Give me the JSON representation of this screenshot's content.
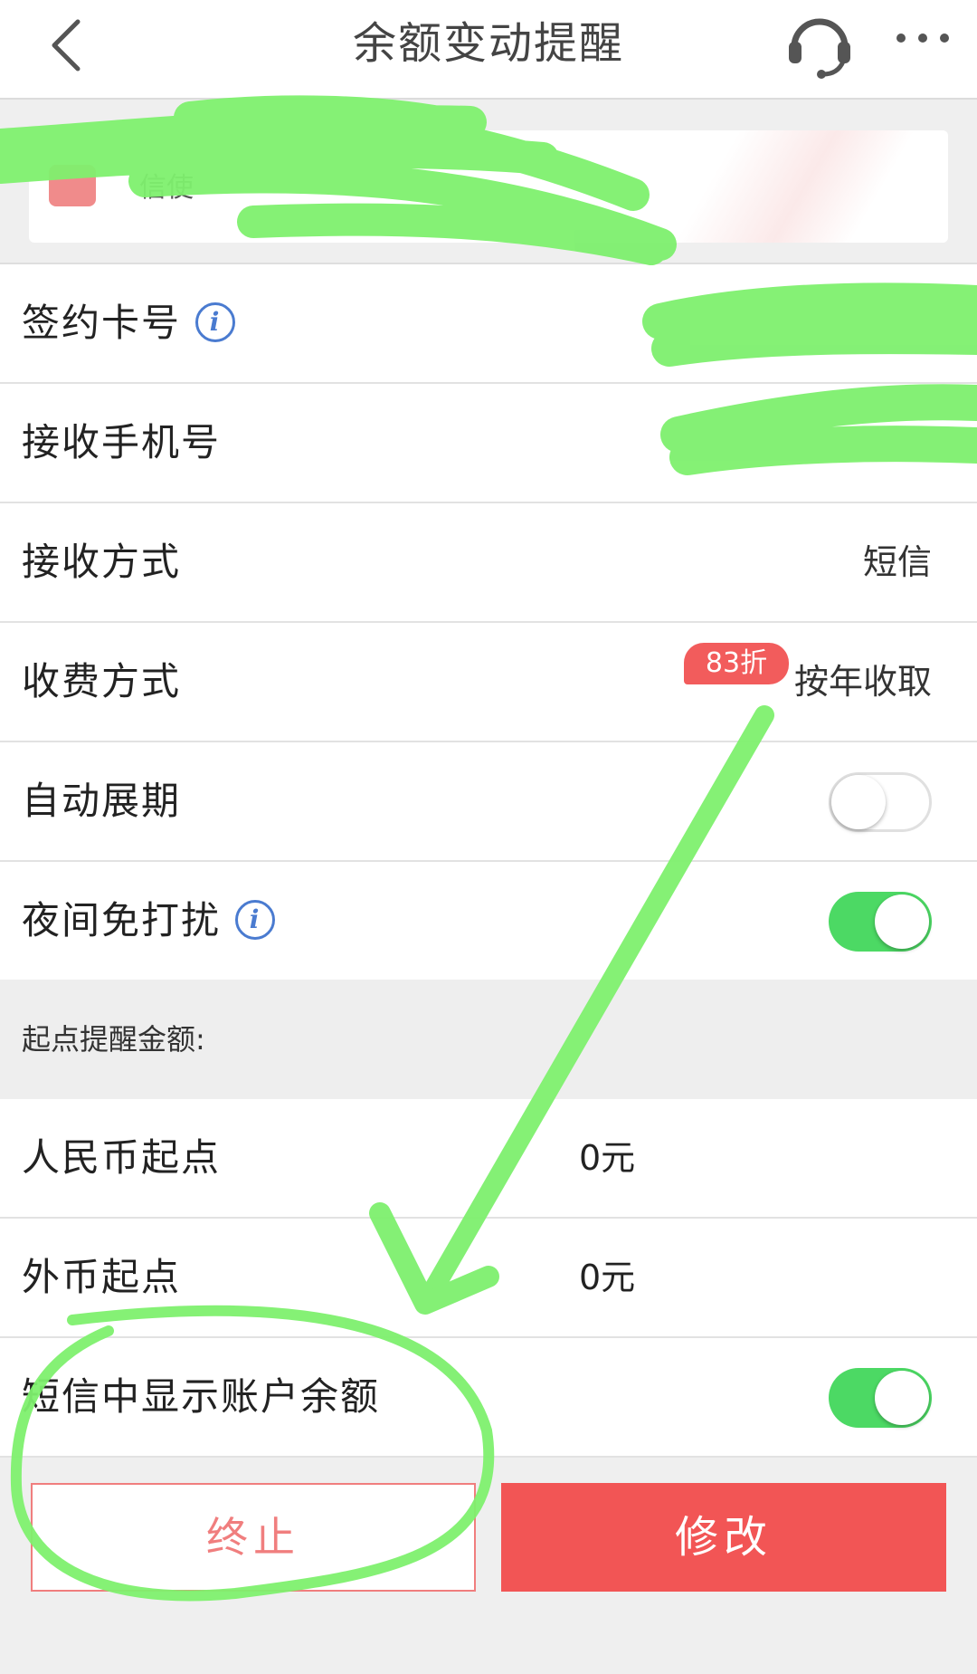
{
  "header": {
    "title": "余额变动提醒"
  },
  "notice": {
    "text": "信使"
  },
  "rows": {
    "card_number": {
      "label": "签约卡号"
    },
    "phone": {
      "label": "接收手机号"
    },
    "receive_method": {
      "label": "接收方式",
      "value": "短信"
    },
    "fee_method": {
      "label": "收费方式",
      "value": "按年收取",
      "badge": "83折"
    },
    "auto_renew": {
      "label": "自动展期",
      "enabled": false
    },
    "night_dnd": {
      "label": "夜间免打扰",
      "enabled": true
    },
    "cny_threshold": {
      "label": "人民币起点",
      "value": "0元"
    },
    "fx_threshold": {
      "label": "外币起点",
      "value": "0元"
    },
    "show_balance": {
      "label": "短信中显示账户余额",
      "enabled": true
    }
  },
  "section": {
    "label": "起点提醒金额:"
  },
  "buttons": {
    "terminate": "终止",
    "modify": "修改"
  },
  "colors": {
    "accent_red": "#f25555",
    "toggle_on": "#4cd964",
    "info_blue": "#4a7bd0",
    "highlighter_green": "#7ef06e"
  },
  "icons": {
    "back": "chevron-left-icon",
    "service": "headset-icon",
    "more": "more-dots-icon",
    "info": "info-icon",
    "bell": "bell-icon"
  }
}
